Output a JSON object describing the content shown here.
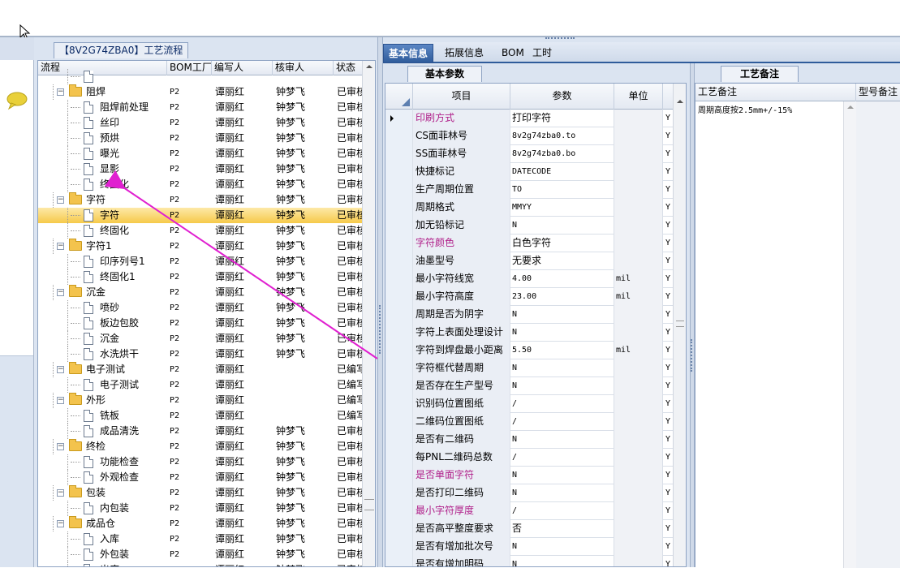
{
  "flow_panel": {
    "title": "【8V2G74ZBA0】工艺流程",
    "columns": [
      "流程",
      "BOM工厂",
      "编写人",
      "核审人",
      "状态"
    ],
    "rows": [
      {
        "level": 1,
        "type": "leaf",
        "name": "",
        "bom": "",
        "writer": "",
        "reviewer": "",
        "status": ""
      },
      {
        "level": 0,
        "type": "group",
        "name": "阻焊",
        "bom": "P2",
        "writer": "谭丽红",
        "reviewer": "钟梦飞",
        "status": "已审核"
      },
      {
        "level": 1,
        "type": "leaf",
        "name": "阻焊前处理",
        "bom": "P2",
        "writer": "谭丽红",
        "reviewer": "钟梦飞",
        "status": "已审核"
      },
      {
        "level": 1,
        "type": "leaf",
        "name": "丝印",
        "bom": "P2",
        "writer": "谭丽红",
        "reviewer": "钟梦飞",
        "status": "已审核"
      },
      {
        "level": 1,
        "type": "leaf",
        "name": "预烘",
        "bom": "P2",
        "writer": "谭丽红",
        "reviewer": "钟梦飞",
        "status": "已审核"
      },
      {
        "level": 1,
        "type": "leaf",
        "name": "曝光",
        "bom": "P2",
        "writer": "谭丽红",
        "reviewer": "钟梦飞",
        "status": "已审核"
      },
      {
        "level": 1,
        "type": "leaf",
        "name": "显影",
        "bom": "P2",
        "writer": "谭丽红",
        "reviewer": "钟梦飞",
        "status": "已审核"
      },
      {
        "level": 1,
        "type": "leaf",
        "name": "终固化",
        "bom": "P2",
        "writer": "谭丽红",
        "reviewer": "钟梦飞",
        "status": "已审核"
      },
      {
        "level": 0,
        "type": "group",
        "name": "字符",
        "bom": "P2",
        "writer": "谭丽红",
        "reviewer": "钟梦飞",
        "status": "已审核"
      },
      {
        "level": 1,
        "type": "leaf",
        "name": "字符",
        "bom": "P2",
        "writer": "谭丽红",
        "reviewer": "钟梦飞",
        "status": "已审核",
        "selected": true
      },
      {
        "level": 1,
        "type": "leaf",
        "name": "终固化",
        "bom": "P2",
        "writer": "谭丽红",
        "reviewer": "钟梦飞",
        "status": "已审核"
      },
      {
        "level": 0,
        "type": "group",
        "name": "字符1",
        "bom": "P2",
        "writer": "谭丽红",
        "reviewer": "钟梦飞",
        "status": "已审核"
      },
      {
        "level": 1,
        "type": "leaf",
        "name": "印序列号1",
        "bom": "P2",
        "writer": "谭丽红",
        "reviewer": "钟梦飞",
        "status": "已审核"
      },
      {
        "level": 1,
        "type": "leaf",
        "name": "终固化1",
        "bom": "P2",
        "writer": "谭丽红",
        "reviewer": "钟梦飞",
        "status": "已审核"
      },
      {
        "level": 0,
        "type": "group",
        "name": "沉金",
        "bom": "P2",
        "writer": "谭丽红",
        "reviewer": "钟梦飞",
        "status": "已审核"
      },
      {
        "level": 1,
        "type": "leaf",
        "name": "喷砂",
        "bom": "P2",
        "writer": "谭丽红",
        "reviewer": "钟梦飞",
        "status": "已审核"
      },
      {
        "level": 1,
        "type": "leaf",
        "name": "板边包胶",
        "bom": "P2",
        "writer": "谭丽红",
        "reviewer": "钟梦飞",
        "status": "已审核"
      },
      {
        "level": 1,
        "type": "leaf",
        "name": "沉金",
        "bom": "P2",
        "writer": "谭丽红",
        "reviewer": "钟梦飞",
        "status": "已审核"
      },
      {
        "level": 1,
        "type": "leaf",
        "name": "水洗烘干",
        "bom": "P2",
        "writer": "谭丽红",
        "reviewer": "钟梦飞",
        "status": "已审核"
      },
      {
        "level": 0,
        "type": "group",
        "name": "电子测试",
        "bom": "P2",
        "writer": "谭丽红",
        "reviewer": "",
        "status": "已编写"
      },
      {
        "level": 1,
        "type": "leaf",
        "name": "电子测试",
        "bom": "P2",
        "writer": "谭丽红",
        "reviewer": "",
        "status": "已编写"
      },
      {
        "level": 0,
        "type": "group",
        "name": "外形",
        "bom": "P2",
        "writer": "谭丽红",
        "reviewer": "",
        "status": "已编写"
      },
      {
        "level": 1,
        "type": "leaf",
        "name": "铣板",
        "bom": "P2",
        "writer": "谭丽红",
        "reviewer": "",
        "status": "已编写"
      },
      {
        "level": 1,
        "type": "leaf",
        "name": "成品清洗",
        "bom": "P2",
        "writer": "谭丽红",
        "reviewer": "钟梦飞",
        "status": "已审核"
      },
      {
        "level": 0,
        "type": "group",
        "name": "终检",
        "bom": "P2",
        "writer": "谭丽红",
        "reviewer": "钟梦飞",
        "status": "已审核"
      },
      {
        "level": 1,
        "type": "leaf",
        "name": "功能检查",
        "bom": "P2",
        "writer": "谭丽红",
        "reviewer": "钟梦飞",
        "status": "已审核"
      },
      {
        "level": 1,
        "type": "leaf",
        "name": "外观检查",
        "bom": "P2",
        "writer": "谭丽红",
        "reviewer": "钟梦飞",
        "status": "已审核"
      },
      {
        "level": 0,
        "type": "group",
        "name": "包装",
        "bom": "P2",
        "writer": "谭丽红",
        "reviewer": "钟梦飞",
        "status": "已审核"
      },
      {
        "level": 1,
        "type": "leaf",
        "name": "内包装",
        "bom": "P2",
        "writer": "谭丽红",
        "reviewer": "钟梦飞",
        "status": "已审核"
      },
      {
        "level": 0,
        "type": "group",
        "name": "成品仓",
        "bom": "P2",
        "writer": "谭丽红",
        "reviewer": "钟梦飞",
        "status": "已审核"
      },
      {
        "level": 1,
        "type": "leaf",
        "name": "入库",
        "bom": "P2",
        "writer": "谭丽红",
        "reviewer": "钟梦飞",
        "status": "已审核"
      },
      {
        "level": 1,
        "type": "leaf",
        "name": "外包装",
        "bom": "P2",
        "writer": "谭丽红",
        "reviewer": "钟梦飞",
        "status": "已审核"
      },
      {
        "level": 1,
        "type": "leaf",
        "name": "出库",
        "bom": "P2",
        "writer": "谭丽红",
        "reviewer": "钟梦飞",
        "status": "已审核"
      }
    ]
  },
  "tabs": [
    "基本信息",
    "拓展信息",
    "BOM",
    "工时"
  ],
  "params_panel": {
    "tab_label": "基本参数",
    "columns": [
      "项目",
      "参数",
      "单位"
    ],
    "rows": [
      {
        "name": "印刷方式",
        "value": "打印字符",
        "unit": "",
        "flag": "Y",
        "highlight": true,
        "current": true
      },
      {
        "name": "CS面菲林号",
        "value": "8v2g74zba0.to",
        "unit": "",
        "flag": "Y"
      },
      {
        "name": "SS面菲林号",
        "value": "8v2g74zba0.bo",
        "unit": "",
        "flag": "Y"
      },
      {
        "name": "快捷标记",
        "value": "DATECODE",
        "unit": "",
        "flag": "Y"
      },
      {
        "name": "生产周期位置",
        "value": "TO",
        "unit": "",
        "flag": "Y"
      },
      {
        "name": "周期格式",
        "value": "MMYY",
        "unit": "",
        "flag": "Y"
      },
      {
        "name": "加无铅标记",
        "value": "N",
        "unit": "",
        "flag": "Y"
      },
      {
        "name": "字符颜色",
        "value": "白色字符",
        "unit": "",
        "flag": "Y",
        "highlight": true
      },
      {
        "name": "油墨型号",
        "value": "无要求",
        "unit": "",
        "flag": "Y"
      },
      {
        "name": "最小字符线宽",
        "value": "4.00",
        "unit": "mil",
        "flag": "Y"
      },
      {
        "name": "最小字符高度",
        "value": "23.00",
        "unit": "mil",
        "flag": "Y"
      },
      {
        "name": "周期是否为阴字",
        "value": "N",
        "unit": "",
        "flag": "Y"
      },
      {
        "name": "字符上表面处理设计",
        "value": "N",
        "unit": "",
        "flag": "Y"
      },
      {
        "name": "字符到焊盘最小距离",
        "value": "5.50",
        "unit": "mil",
        "flag": "Y"
      },
      {
        "name": "字符框代替周期",
        "value": "N",
        "unit": "",
        "flag": "Y"
      },
      {
        "name": "是否存在生产型号",
        "value": "N",
        "unit": "",
        "flag": "Y"
      },
      {
        "name": "识别码位置图纸",
        "value": "/",
        "unit": "",
        "flag": "Y"
      },
      {
        "name": "二维码位置图纸",
        "value": "/",
        "unit": "",
        "flag": "Y"
      },
      {
        "name": "是否有二维码",
        "value": "N",
        "unit": "",
        "flag": "Y"
      },
      {
        "name": "每PNL二维码总数",
        "value": "/",
        "unit": "",
        "flag": "Y"
      },
      {
        "name": "是否单面字符",
        "value": "N",
        "unit": "",
        "flag": "Y",
        "highlight": true
      },
      {
        "name": "是否打印二维码",
        "value": "N",
        "unit": "",
        "flag": "Y"
      },
      {
        "name": "最小字符厚度",
        "value": "/",
        "unit": "",
        "flag": "Y",
        "highlight": true
      },
      {
        "name": "是否高平整度要求",
        "value": "否",
        "unit": "",
        "flag": "Y"
      },
      {
        "name": "是否有增加批次号",
        "value": "N",
        "unit": "",
        "flag": "Y"
      },
      {
        "name": "是否有增加明码",
        "value": "N",
        "unit": "",
        "flag": "Y"
      }
    ]
  },
  "notes_panel": {
    "tab_label": "工艺备注",
    "columns": [
      "工艺备注",
      "型号备注"
    ],
    "note_text": "周期高度按2.5mm+/-15%"
  },
  "colors": {
    "accent": "#2f5c9b",
    "highlight_text": "#b0208a",
    "selected_row": "#f6c94a",
    "annotation_arrow": "#e020d0"
  }
}
